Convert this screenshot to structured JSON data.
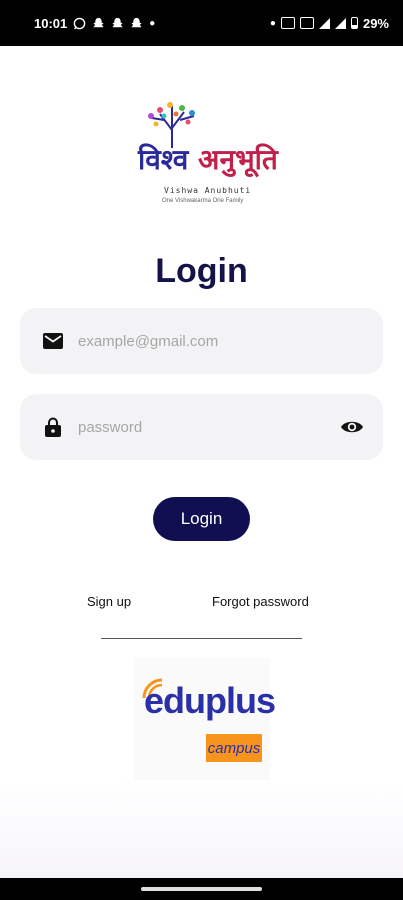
{
  "status_bar": {
    "time": "10:01",
    "battery_text": "29%",
    "left_icons": [
      "whatsapp-icon",
      "snapchat-icon",
      "snapchat-icon",
      "snapchat-icon",
      "dot-icon"
    ],
    "right_icons": [
      "dot-icon",
      "sim-icon",
      "sim-icon",
      "signal-icon",
      "signal-icon",
      "battery-icon"
    ]
  },
  "logo": {
    "title_part1": "विश्व ",
    "title_part2": "अनुभूति",
    "roman": "Vishwa  Anubhuti",
    "tagline": "One Vishwakarma One Family"
  },
  "page_title": "Login",
  "email": {
    "placeholder": "example@gmail.com",
    "icon": "mail-icon"
  },
  "password": {
    "placeholder": "password",
    "icon": "lock-icon",
    "toggle_icon": "eye-icon"
  },
  "login_button": "Login",
  "links": {
    "signup": "Sign up",
    "forgot": "Forgot password"
  },
  "footer_logo": {
    "word": "eduplus",
    "badge": "campus"
  },
  "colors": {
    "primary": "#0f0f52",
    "field_bg": "#f3f3f5",
    "edu_blue": "#2b2fa8",
    "edu_orange": "#f7941d"
  }
}
